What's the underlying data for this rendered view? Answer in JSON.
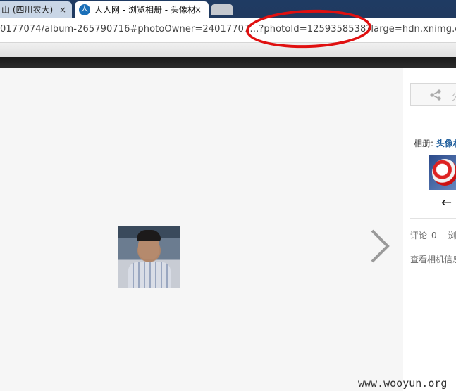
{
  "browser": {
    "tabs": [
      {
        "title": "山 (四川农大)",
        "close": "×"
      },
      {
        "logo": "人",
        "title": "人人网 - 浏览相册 - 头像材",
        "close": "×"
      }
    ],
    "url": "0177074/album-265790716#photoOwner=24017707…?photoId=1259358538?large=hdn.xnimg.cn/"
  },
  "sidebar": {
    "share_label": "分",
    "album_prefix": "相册:",
    "album_name": "头像材",
    "prev_arrow": "←",
    "comment_label": "评论",
    "comment_count": "0",
    "browse_label": "浏",
    "camera_info": "查看相机信息"
  },
  "icons": {
    "share": "share-icon",
    "next": "chevron-right-icon",
    "prev": "arrow-left-icon",
    "renren_logo": "renren-logo-icon"
  },
  "colors": {
    "annotation_red": "#e01010",
    "link_blue": "#1a5a9a",
    "tabbar_blue": "#1f3b63"
  },
  "watermark": "www.wooyun.org"
}
